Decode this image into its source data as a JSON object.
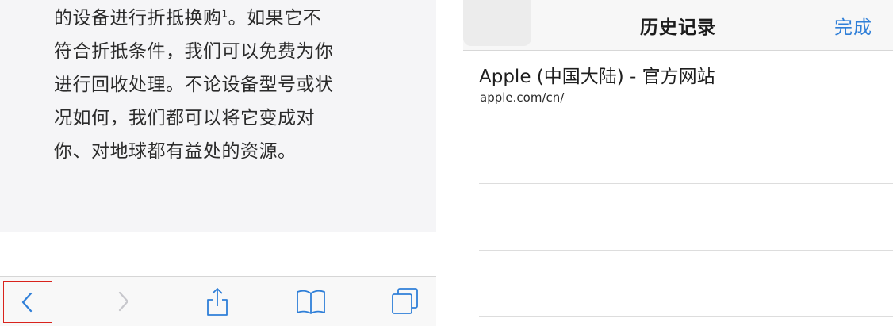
{
  "left_panel": {
    "paragraph_lines": [
      "的设备进行折抵换购",
      "符合折抵条件，我们可以免费为你",
      "进行回收处理。不论设备型号或状",
      "况如何，我们都可以将它变成对",
      "你、对地球都有益处的资源。"
    ],
    "footnote_mark": "1",
    "line1_tail": "。如果它不",
    "toolbar": {
      "icons": [
        "back-icon",
        "forward-icon",
        "share-icon",
        "bookmarks-icon",
        "tabs-icon"
      ],
      "active_color": "#2f7fd8",
      "disabled_color": "#c7c7cc",
      "highlight_color": "#d9231c"
    }
  },
  "right_panel": {
    "nav": {
      "title": "历史记录",
      "done_label": "完成"
    },
    "history": [
      {
        "title": "Apple (中国大陆) - 官方网站",
        "url": "apple.com/cn/"
      },
      {
        "title": "",
        "url": ""
      },
      {
        "title": "",
        "url": ""
      },
      {
        "title": "",
        "url": ""
      }
    ]
  }
}
